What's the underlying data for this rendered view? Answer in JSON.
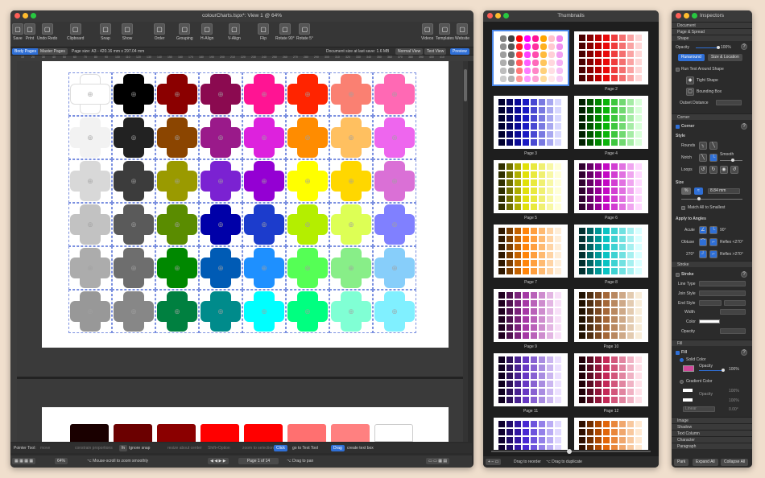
{
  "main_window": {
    "title": "colourCharts.lspx*: View 1 @ 64%",
    "toolbar": [
      {
        "label": "Save",
        "icon": "save-icon"
      },
      {
        "label": "Print",
        "icon": "print-icon"
      },
      {
        "label": "Undo Redo",
        "icon": "undo-redo-icon"
      },
      {
        "label": "Clipboard",
        "icon": "clipboard-icon"
      },
      {
        "label": "Snap",
        "icon": "snap-icon"
      },
      {
        "label": "Show",
        "icon": "show-icon"
      },
      {
        "label": "Order",
        "icon": "order-icon"
      },
      {
        "label": "Grouping",
        "icon": "grouping-icon"
      },
      {
        "label": "H-Align",
        "icon": "h-align-icon"
      },
      {
        "label": "V-Align",
        "icon": "v-align-icon"
      },
      {
        "label": "Flip",
        "icon": "flip-icon"
      },
      {
        "label": "Rotate 90°",
        "icon": "rotate-90-icon"
      },
      {
        "label": "Rotate 5°",
        "icon": "rotate-5-icon"
      },
      {
        "label": "Videos",
        "icon": "videos-icon"
      },
      {
        "label": "Templates",
        "icon": "templates-icon"
      },
      {
        "label": "Website",
        "icon": "website-icon"
      }
    ],
    "options_bar": {
      "body_pages": "Body Pages",
      "master_pages": "Master Pages",
      "page_size": "Page size:  A3 - 420.16 mm x 297.04 mm",
      "doc_size": "Document size at last save:  1.6 MB",
      "normal_view": "Normal View",
      "text_view": "Text View",
      "preview": "Preview"
    },
    "ruler_ticks": [
      "10",
      "20",
      "30",
      "40",
      "50",
      "60",
      "70",
      "80",
      "90",
      "100",
      "110",
      "120",
      "130",
      "140",
      "150",
      "160",
      "170",
      "180",
      "190",
      "200",
      "210",
      "220",
      "230",
      "240",
      "250",
      "260",
      "270",
      "280",
      "290",
      "300",
      "310",
      "320",
      "330",
      "340",
      "350",
      "360",
      "370",
      "380",
      "390",
      "400",
      "410"
    ],
    "grid_colors": [
      [
        "#ffffff",
        "#000000",
        "#8b0000",
        "#8b0a50",
        "#ff1493",
        "#ff2400",
        "#fa8072",
        "#ff69b4"
      ],
      [
        "#f2f2f2",
        "#222222",
        "#8b4500",
        "#9a1a8a",
        "#dd22dd",
        "#ff8c00",
        "#ffc060",
        "#ee66ee"
      ],
      [
        "#d8d8d8",
        "#3c3c3c",
        "#9a9a00",
        "#7b22d2",
        "#9400d3",
        "#ffff00",
        "#ffd700",
        "#da70d6"
      ],
      [
        "#c2c2c2",
        "#5a5a5a",
        "#5a8c00",
        "#0000a8",
        "#1c3ccc",
        "#b4ee00",
        "#ddff55",
        "#8080ff"
      ],
      [
        "#acacac",
        "#6e6e6e",
        "#008800",
        "#005bb5",
        "#1e90ff",
        "#55ff55",
        "#88ee88",
        "#87cefa"
      ],
      [
        "#989898",
        "#878787",
        "#008040",
        "#008b8b",
        "#00ffff",
        "#00ff80",
        "#80ffd4",
        "#80f0ff"
      ]
    ],
    "second_page_colors": [
      "#1a0000",
      "#6b0000",
      "#8b0000",
      "#ff0000",
      "#ff0000",
      "#ff7070",
      "#ff8080",
      "#ffffff"
    ],
    "status": {
      "pointer_tool": "Pointer Tool:",
      "hint1": "move",
      "hint2": "constrain proportions",
      "ignore_snap_key": "fn",
      "ignore_snap": "Ignore snap",
      "hint3": "resize about center",
      "hint4": "Shift+Option",
      "hint5": "zoom to selection",
      "click_key": "Click",
      "goto_text": "go to Text Tool",
      "drag_key": "Drag",
      "create_text": "create text box"
    },
    "bottom": {
      "zoom": "64%",
      "scroll_hint": "⌥ Mouse-scroll to zoom smoothly",
      "page": "Page 1 of 14",
      "pan_hint": "⌥ Drag to pan"
    }
  },
  "thumbnails": {
    "title": "Thumbnails",
    "pages": [
      {
        "label": "",
        "palette": [
          "#ff0000",
          "#ffffff"
        ]
      },
      {
        "label": "Page 2",
        "palette": [
          "#4a0000",
          "#e80000",
          "#ffd6d6"
        ]
      },
      {
        "label": "Page 3",
        "palette": [
          "#000030",
          "#1010c0",
          "#d8d8ff"
        ]
      },
      {
        "label": "Page 4",
        "palette": [
          "#002000",
          "#00b000",
          "#d8ffd8"
        ]
      },
      {
        "label": "Page 5",
        "palette": [
          "#303000",
          "#e0e000",
          "#ffffd8"
        ]
      },
      {
        "label": "Page 6",
        "palette": [
          "#300030",
          "#c000c0",
          "#ffd8ff"
        ]
      },
      {
        "label": "Page 7",
        "palette": [
          "#301800",
          "#ff8000",
          "#ffeed8"
        ]
      },
      {
        "label": "Page 8",
        "palette": [
          "#003030",
          "#00c0c0",
          "#d8ffff"
        ]
      },
      {
        "label": "Page 9",
        "palette": [
          "#200020",
          "#a030a0",
          "#f8e0f8"
        ]
      },
      {
        "label": "Page 10",
        "palette": [
          "#201000",
          "#a06030",
          "#f8ecd8"
        ]
      },
      {
        "label": "Page 11",
        "palette": [
          "#100020",
          "#6030c0",
          "#ece0ff"
        ]
      },
      {
        "label": "Page 12",
        "palette": [
          "#200008",
          "#c02050",
          "#ffe0e8"
        ]
      },
      {
        "label": "",
        "palette": [
          "#100030",
          "#4020d0",
          "#e0d8ff"
        ]
      },
      {
        "label": "",
        "palette": [
          "#301000",
          "#e06000",
          "#ffe8d0"
        ]
      }
    ],
    "footer_reorder": "Drag to reorder",
    "footer_duplicate": "⌥ Drag to duplicate"
  },
  "inspectors": {
    "title": "Inspectors",
    "sections": {
      "document": "Document",
      "page_spread": "Page & Spread",
      "shape": "Shape",
      "corner": "Corner",
      "stroke": "Stroke",
      "fill": "Fill",
      "image": "Image",
      "shadow": "Shadow",
      "text_column": "Text Column",
      "character": "Character",
      "paragraph": "Paragraph"
    },
    "shape": {
      "opacity_label": "Opacity",
      "opacity_value": "100%",
      "runaround": "Runaround",
      "size_location": "Size & Location",
      "run_text": "Run Text Around Shape",
      "tight": "Tight Shape",
      "bounding": "Bounding Box",
      "outset": "Outset Distance"
    },
    "corner": {
      "label": "Corner",
      "style": "Style",
      "rounds": "Rounds",
      "smooth": "Smooth",
      "notch": "Notch",
      "loops": "Loops",
      "size": "Size",
      "unit": "%",
      "size_value": "8.84 mm",
      "match": "Match All to Smallest",
      "apply": "Apply to Angles",
      "acute": "Acute",
      "acute_val": "90°",
      "obtuse": "Obtuse",
      "obtuse_val": "Reflex <270°",
      "a270": "270°",
      "reflex": "Reflex >270°"
    },
    "stroke": {
      "label": "Stroke",
      "line_type": "Line Type",
      "join": "Join Style",
      "end": "End Style",
      "width": "Width",
      "color": "Color",
      "opacity": "Opacity"
    },
    "fill": {
      "label": "Fill",
      "solid": "Solid Color",
      "opacity": "Opacity",
      "opacity_value": "100%",
      "swatch": "#d1479a",
      "gradient": "Gradient Color",
      "g_opacity": "Opacity",
      "g1": "100%",
      "g2": "100%",
      "linear": "Linear",
      "angle": "0.00°"
    },
    "footer": {
      "park": "Park",
      "expand": "Expand All",
      "collapse": "Collapse All"
    }
  }
}
